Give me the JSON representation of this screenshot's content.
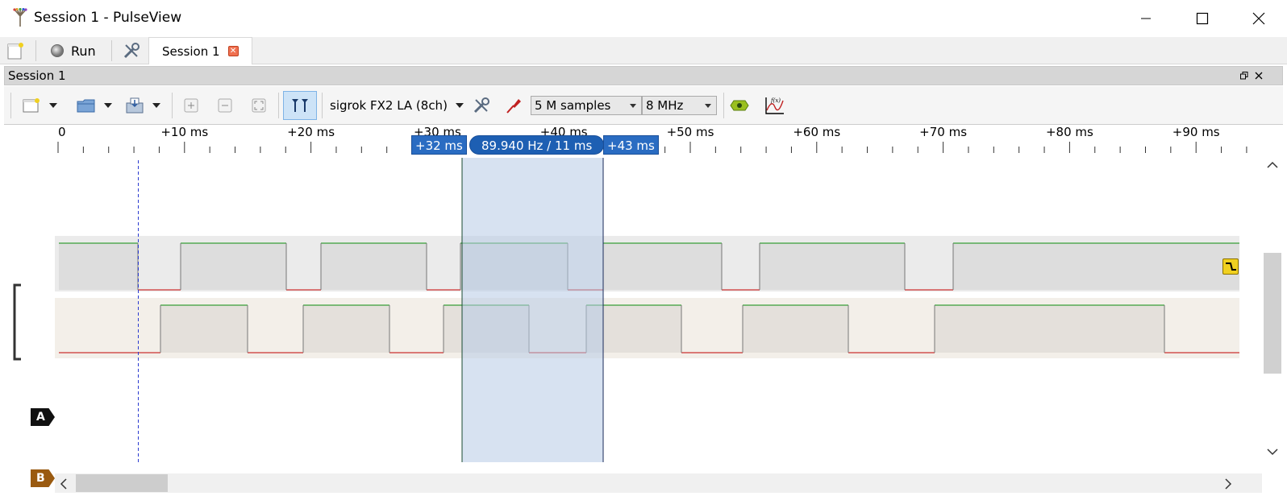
{
  "window": {
    "title": "Session 1 - PulseView"
  },
  "tabbar": {
    "run_label": "Run",
    "tab_label": "Session 1"
  },
  "dock": {
    "title": "Session 1"
  },
  "toolbar": {
    "device": "sigrok FX2 LA (8ch)",
    "samples": "5 M samples",
    "rate": "8 MHz"
  },
  "ruler": {
    "ticks": [
      "0",
      "+10 ms",
      "+20 ms",
      "+30 ms",
      "+40 ms",
      "+50 ms",
      "+60 ms",
      "+70 ms",
      "+80 ms",
      "+90 ms"
    ]
  },
  "cursors": {
    "left_label": "+32 ms",
    "measure_label": "89.940 Hz / 11 ms",
    "right_label": "+43 ms"
  },
  "channels": [
    {
      "name": "A",
      "color": "#111111"
    },
    {
      "name": "B",
      "color": "#9a5a10"
    }
  ],
  "colors": {
    "high": "#3aa53a",
    "low": "#cc3030",
    "cursor_fill": "#c8d7ea",
    "accent": "#2a6cc2"
  }
}
